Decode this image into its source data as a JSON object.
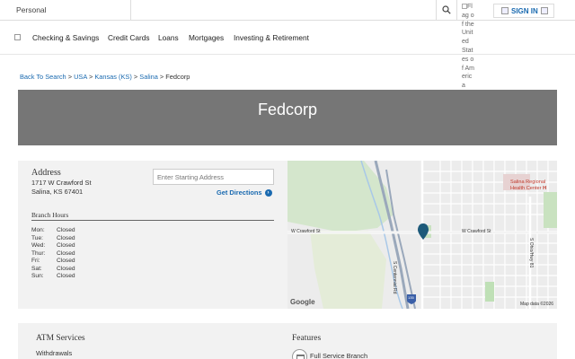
{
  "topbar": {
    "personal_label": "Personal",
    "flag_alt": "Flag of the United States of America",
    "signin_label": "SIGN IN"
  },
  "nav": {
    "items": [
      "Checking & Savings",
      "Credit Cards",
      "Loans",
      "Mortgages",
      "Investing & Retirement"
    ]
  },
  "breadcrumb": {
    "back": "Back To Search",
    "country": "USA",
    "state": "Kansas (KS)",
    "city": "Salina",
    "current": "Fedcorp",
    "separator": ">"
  },
  "hero": {
    "title": "Fedcorp"
  },
  "address": {
    "heading": "Address",
    "line1": "1717 W Crawford St",
    "line2": "Salina, KS 67401"
  },
  "directions": {
    "placeholder": "Enter Starting Address",
    "button_label": "Get Directions"
  },
  "hours": {
    "heading": "Branch Hours",
    "rows": [
      {
        "day": "Mon:",
        "status": "Closed"
      },
      {
        "day": "Tue:",
        "status": "Closed"
      },
      {
        "day": "Wed:",
        "status": "Closed"
      },
      {
        "day": "Thur:",
        "status": "Closed"
      },
      {
        "day": "Fri:",
        "status": "Closed"
      },
      {
        "day": "Sat:",
        "status": "Closed"
      },
      {
        "day": "Sun:",
        "status": "Closed"
      }
    ]
  },
  "map": {
    "street_left": "W Crawford St",
    "street_right": "W Crawford St",
    "road_vertical": "S Centennial Rd",
    "road_right": "S Ohio/Hwy 81",
    "poi": "Salina Regional Health Center",
    "poi_marker": "H",
    "highway_shield": "135",
    "logo": "Google",
    "credit": "Map data ©2026",
    "marker_color": "#1d5a7a"
  },
  "atm": {
    "heading": "ATM Services",
    "value": "Withdrawals"
  },
  "features": {
    "heading": "Features",
    "value": "Full Service Branch"
  },
  "colors": {
    "link": "#1a6ab0",
    "hero_bg": "#767676",
    "panel_bg": "#f2f2f2"
  }
}
